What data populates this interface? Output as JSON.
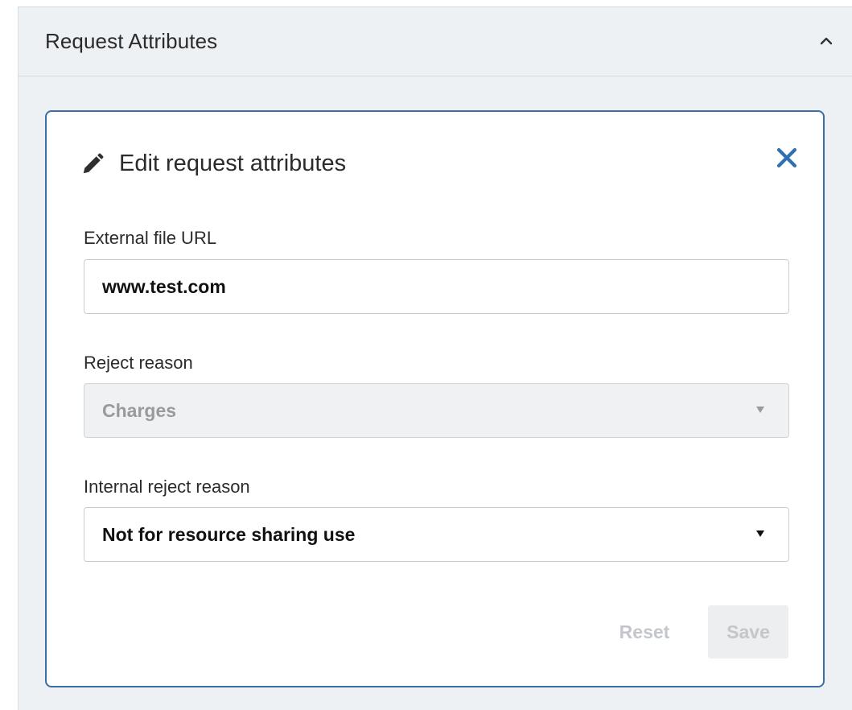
{
  "panel": {
    "title": "Request Attributes",
    "collapse_icon": "chevron-up-icon"
  },
  "card": {
    "title": "Edit request attributes",
    "edit_icon": "pencil-icon",
    "close_icon": "close-icon",
    "accent_color": "#3a6ea5"
  },
  "fields": {
    "external_url": {
      "label": "External file URL",
      "value": "www.test.com"
    },
    "reject_reason": {
      "label": "Reject reason",
      "value": "Charges",
      "disabled": true
    },
    "internal_reject_reason": {
      "label": "Internal reject reason",
      "value": "Not for resource sharing use"
    }
  },
  "actions": {
    "reset_label": "Reset",
    "save_label": "Save"
  }
}
